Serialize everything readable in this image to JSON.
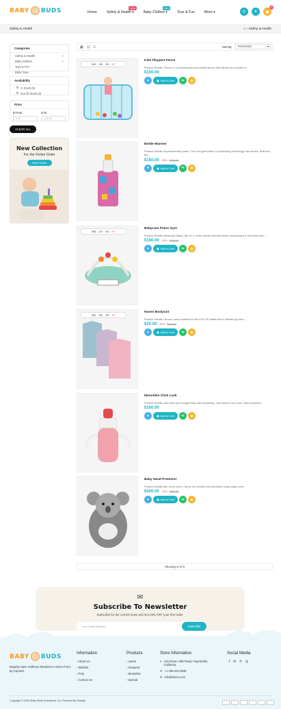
{
  "brand": {
    "word1": "BABY",
    "word2": "BUDS"
  },
  "nav": [
    {
      "label": "Home",
      "tag": "",
      "tag_color": ""
    },
    {
      "label": "Safety & Health",
      "tag": "SALE",
      "tag_color": "#f0506e"
    },
    {
      "label": "Baby Clothes",
      "tag": "NEW",
      "tag_color": "#21b4c5"
    },
    {
      "label": "Toys & Fun",
      "tag": "",
      "tag_color": ""
    },
    {
      "label": "More",
      "tag": "",
      "tag_color": ""
    }
  ],
  "header_icons": [
    "search-icon",
    "user-icon",
    "cart-icon"
  ],
  "cart_count": "0",
  "breadcrumb": {
    "left": "Safety & Health",
    "right": "Safety & Health"
  },
  "filters": {
    "categories": {
      "title": "Categories",
      "items": [
        "Safety & Health",
        "Baby Clothes",
        "Toys & Fun",
        "Baby Care"
      ]
    },
    "availability": {
      "title": "Availability",
      "items": [
        "In Stock (6)",
        "Out Of Stock (0)"
      ]
    },
    "price": {
      "title": "Price",
      "from_label": "$ From",
      "to_label": "$ To",
      "from_placeholder": "0.00",
      "to_placeholder": "200.00"
    },
    "clear_label": "CLEAR ALL"
  },
  "banner": {
    "title": "New Collection",
    "subtitle": "For the Online Order",
    "button": "SHOP NOW"
  },
  "toolbar": {
    "sort_label": "Sort By",
    "sort_value": "FEATURED"
  },
  "products": [
    {
      "title": "Kids Playpen Fence",
      "desc": "Product Details: iPhone is a revolutionary new mobile phone that allows you to make a...",
      "price": "$100.00",
      "off": "",
      "old": "",
      "timer": [
        "241",
        "08",
        "33",
        "47"
      ]
    },
    {
      "title": "Bottle Warmer",
      "desc": "Product Details Unprecedented power. The next generation of processing technology has arrived. Built into the...",
      "price": "$150.00",
      "off": "-25%",
      "old": "$200.00",
      "timer": []
    },
    {
      "title": "Babycare Piano Gym",
      "desc": "Product Details Samsung Galaxy Tab 10.1, is the world's thinnest tablet, measuring 8.6 mm thickness,...",
      "price": "$180.00",
      "off": "-10%",
      "old": "$200.00",
      "timer": [
        "353",
        "20",
        "53",
        "47"
      ]
    },
    {
      "title": "Hanes Bodysuit",
      "desc": "Product Details Canon's press material for the EOS 5D states that it 'defines (a) new...",
      "price": "$20.00",
      "off": "-91%",
      "old": "$222.00",
      "timer": [
        "322",
        "08",
        "33",
        "47"
      ]
    },
    {
      "title": "Munchkin Click Lock",
      "desc": "Product Details Just when you thought iMac had everything, now there's even more. More powerful...",
      "price": "$100.00",
      "off": "",
      "old": "",
      "timer": []
    },
    {
      "title": "Baby Head Protector",
      "desc": "Product Details Born to be worn. Clip on the worlds most wearable music player and...",
      "price": "$300.00",
      "off": "-14%",
      "old": "$350.00",
      "timer": []
    }
  ],
  "add_to_cart": "Add to Cart",
  "showing": "Showing 6 of 6",
  "newsletter": {
    "title": "Subscribe To Newsletter",
    "subtitle": "Subscribe for the current news and Get 20% OFF your first order.",
    "placeholder": "Your Email Address",
    "button": "Subscribe"
  },
  "footer": {
    "about": "Majority Have Suffered Alteration In Some Form, By Injected.",
    "info": {
      "title": "Information",
      "items": [
        "About Us",
        "Wishlist",
        "FAQ",
        "Contact Us"
      ]
    },
    "products": {
      "title": "Products",
      "items": [
        "Latest",
        "Featured",
        "Bestseller",
        "Special"
      ]
    },
    "store": {
      "title": "Store Information",
      "address": "A20 Green Hills Road, Fayetteville, California,",
      "phone": "+1 208-223-3635",
      "email": "info@demo.com"
    },
    "social": {
      "title": "Social Media",
      "icons": [
        "facebook-icon",
        "linkedin-icon",
        "pinterest-icon",
        "instagram-icon"
      ]
    },
    "copyright": "Copyright © 2025 Baby Buds (Password: 4) | Powered By Shopify",
    "payments": [
      "visa-icon",
      "mastercard-icon",
      "amex-icon",
      "paypal-icon",
      "diners-icon",
      "discover-icon"
    ]
  },
  "colors": {
    "accent": "#21b4c5",
    "orange": "#f59b1f",
    "green": "#29c26a",
    "yellow": "#f5b52e",
    "blue": "#4ab0e8"
  }
}
